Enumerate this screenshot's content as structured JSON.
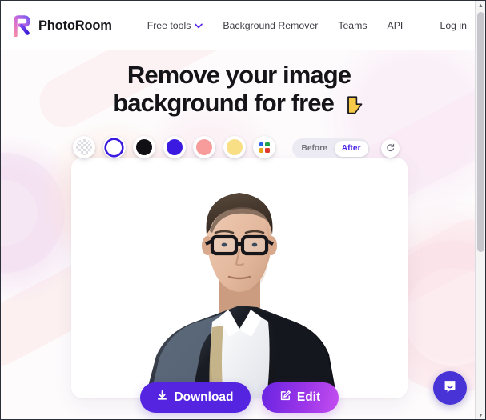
{
  "header": {
    "brand_name": "PhotoRoom",
    "logo_icon": "photoroom-r-logo-icon",
    "nav_items": [
      {
        "label": "Free tools",
        "has_chevron": true,
        "icon": "chevron-down-icon"
      },
      {
        "label": "Background Remover",
        "has_chevron": false
      },
      {
        "label": "Teams",
        "has_chevron": false
      },
      {
        "label": "API",
        "has_chevron": false
      }
    ],
    "login_label": "Log in"
  },
  "hero": {
    "headline_line1": "Remove your image",
    "headline_line2": "background for free",
    "hand_emoji": "👇",
    "hand_icon": "pointing-down-hand-icon"
  },
  "editor": {
    "swatches": [
      {
        "name": "transparent",
        "type": "checkerboard",
        "color": ""
      },
      {
        "name": "white",
        "type": "solid",
        "color": "#ffffff",
        "selected": true
      },
      {
        "name": "black",
        "type": "solid",
        "color": "#100f14"
      },
      {
        "name": "blue-violet",
        "type": "solid",
        "color": "#3b19e0"
      },
      {
        "name": "salmon-pink",
        "type": "solid",
        "color": "#f79b9b"
      },
      {
        "name": "light-yellow",
        "type": "solid",
        "color": "#f8df86"
      },
      {
        "name": "color-picker",
        "type": "picker",
        "colors": [
          "#2563eb",
          "#22a24a",
          "#e8a517",
          "#e0392b"
        ]
      }
    ],
    "selected_swatch_index": 1,
    "toggle": {
      "before_label": "Before",
      "after_label": "After",
      "active": "After",
      "active_color": "#4a24e8"
    },
    "reset_icon": "reset-refresh-icon",
    "photo_alt": "man-with-glasses-in-dark-suit-cutout"
  },
  "actions": {
    "download_label": "Download",
    "download_icon": "download-icon",
    "download_color": "#5524e0",
    "edit_label": "Edit",
    "edit_icon": "edit-pencil-square-icon",
    "edit_gradient_from": "#6a24e2",
    "edit_gradient_to": "#c44ef0"
  },
  "chat": {
    "icon": "chat-bubble-smile-icon",
    "color": "#4733d6"
  },
  "scrollbar": {
    "up_arrow": "▲",
    "down_arrow": "▼"
  }
}
